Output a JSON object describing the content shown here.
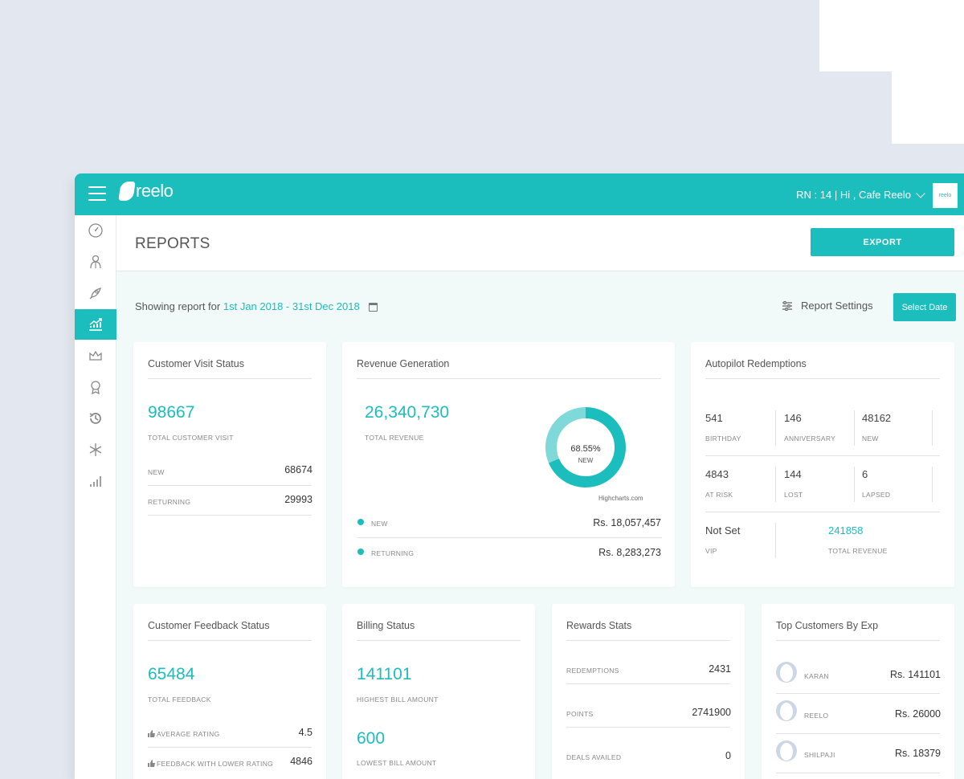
{
  "app": {
    "brand": "reelo",
    "user_label": "RN : 14 |  Hi ,  Cafe Reelo",
    "avatar_text": "reelo"
  },
  "sidebar": {
    "items": [
      {
        "icon": "dashboard-icon"
      },
      {
        "icon": "customers-icon"
      },
      {
        "icon": "campaign-rocket-icon"
      },
      {
        "icon": "reports-chart-icon",
        "active": true
      },
      {
        "icon": "crown-icon"
      },
      {
        "icon": "award-badge-icon"
      },
      {
        "icon": "history-icon"
      },
      {
        "icon": "snowflake-icon"
      },
      {
        "icon": "bar-signal-icon"
      }
    ]
  },
  "header": {
    "title": "REPORTS",
    "export_label": "EXPORT"
  },
  "report_bar": {
    "prefix": "Showing report for",
    "date_range": "1st Jan 2018 - 31st Dec 2018",
    "settings_label": "Report Settings",
    "select_date_label": "Select Date"
  },
  "visit_status": {
    "title": "Customer Visit Status",
    "total": "98667",
    "total_label": "TOTAL CUSTOMER VISIT",
    "rows": [
      {
        "label": "NEW",
        "value": "68674"
      },
      {
        "label": "RETURNING",
        "value": "29993"
      }
    ]
  },
  "revenue": {
    "title": "Revenue Generation",
    "total": "26,340,730",
    "total_label": "TOTAL REVENUE",
    "donut_pct": "68.55%",
    "donut_label": "NEW",
    "credit": "Highcharts.com",
    "rows": [
      {
        "label": "NEW",
        "value": "Rs. 18,057,457"
      },
      {
        "label": "RETURNING",
        "value": "Rs. 8,283,273"
      }
    ]
  },
  "chart_data": {
    "type": "pie",
    "title": "",
    "categories": [
      "NEW",
      "RETURNING"
    ],
    "values": [
      68.55,
      31.45
    ],
    "colors": [
      "#1cbdbd",
      "#7fd9d9"
    ]
  },
  "autopilot": {
    "title": "Autopilot Redemptions",
    "stats": [
      {
        "value": "541",
        "label": "BIRTHDAY"
      },
      {
        "value": "146",
        "label": "ANNIVERSARY"
      },
      {
        "value": "48162",
        "label": "NEW"
      },
      {
        "value": "4843",
        "label": "AT RISK"
      },
      {
        "value": "144",
        "label": "LOST"
      },
      {
        "value": "6",
        "label": "LAPSED"
      }
    ],
    "vip_value": "Not Set",
    "vip_label": "VIP",
    "revenue_value": "241858",
    "revenue_label": "TOTAL REVENUE"
  },
  "feedback": {
    "title": "Customer Feedback Status",
    "total": "65484",
    "total_label": "TOTAL FEEDBACK",
    "rows": [
      {
        "label": "AVERAGE RATING",
        "value": "4.5"
      },
      {
        "label": "FEEDBACK WITH LOWER RATING",
        "value": "4846"
      }
    ]
  },
  "billing": {
    "title": "Billing Status",
    "highest": "141101",
    "highest_label": "HIGHEST BILL AMOUNT",
    "lowest": "600",
    "lowest_label": "LOWEST BILL AMOUNT"
  },
  "rewards": {
    "title": "Rewards Stats",
    "rows": [
      {
        "label": "REDEMPTIONS",
        "value": "2431"
      },
      {
        "label": "POINTS",
        "value": "2741900"
      },
      {
        "label": "DEALS AVAILED",
        "value": "0"
      }
    ]
  },
  "top_customers": {
    "title": "Top Customers By Exp",
    "rows": [
      {
        "name": "KARAN",
        "value": "Rs. 141101"
      },
      {
        "name": "REELO",
        "value": "Rs. 26000"
      },
      {
        "name": "SHILPAJI",
        "value": "Rs. 18379"
      }
    ]
  }
}
